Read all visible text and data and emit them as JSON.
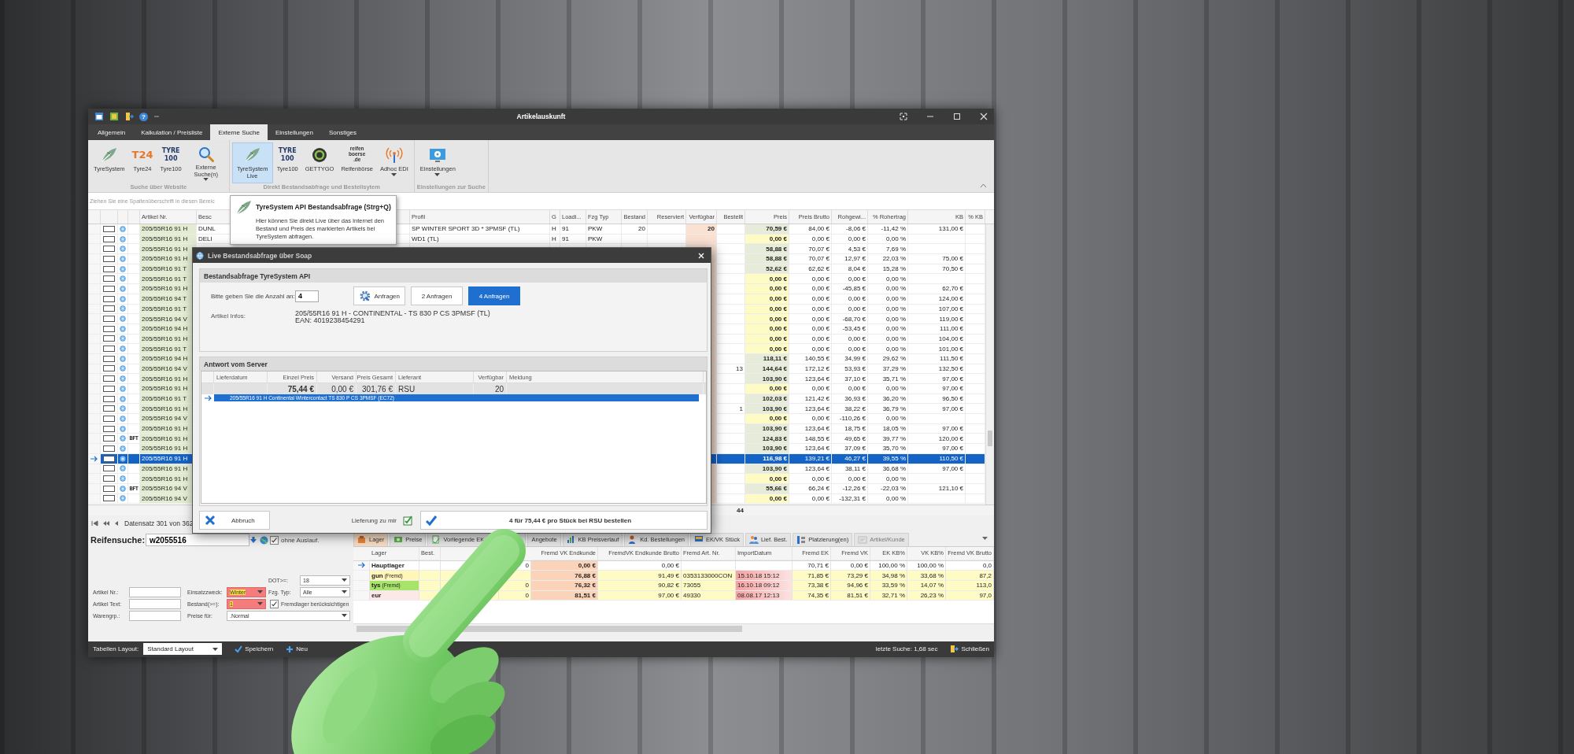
{
  "window": {
    "title": "Artikelauskunft",
    "help": "?"
  },
  "ribbon_tabs": [
    {
      "label": "Allgemein",
      "selected": false
    },
    {
      "label": "Kalkulation / Preisliste",
      "selected": false
    },
    {
      "label": "Externe Suche",
      "selected": true
    },
    {
      "label": "Einstellungen",
      "selected": false
    },
    {
      "label": "Sonstiges",
      "selected": false
    }
  ],
  "ribbon_groups": [
    {
      "label": "Suche über Website",
      "buttons": [
        {
          "label": "TyreSystem",
          "kind": "leaf",
          "dropdown": false,
          "selected": false
        },
        {
          "label": "Tyre24",
          "kind": "t24",
          "logo": "T24",
          "dropdown": false,
          "selected": false
        },
        {
          "label": "Tyre100",
          "kind": "tyre100",
          "logo": "TYRE\n100",
          "dropdown": false,
          "selected": false
        },
        {
          "label": "Externe Suche(n)",
          "kind": "magnifier",
          "dropdown": true,
          "selected": false
        }
      ]
    },
    {
      "label": "Direkt Bestandsabfrage und Bestellsytem",
      "buttons": [
        {
          "label": "TyreSystem Live",
          "kind": "leaf",
          "dropdown": false,
          "selected": true
        },
        {
          "label": "Tyre100",
          "kind": "tyre100",
          "logo": "TYRE\n100",
          "dropdown": false,
          "selected": false
        },
        {
          "label": "GETTYGO",
          "kind": "ring",
          "dropdown": false,
          "selected": false
        },
        {
          "label": "Reifenbörse",
          "kind": "boerse",
          "logo": "reifen\nboerse\n.de",
          "dropdown": false,
          "selected": false
        },
        {
          "label": "Adhoc EDI",
          "kind": "antenna",
          "dropdown": true,
          "selected": false
        }
      ]
    },
    {
      "label": "Einstellungen zur Suche",
      "buttons": [
        {
          "label": "Einstellungen",
          "kind": "settings",
          "dropdown": true,
          "selected": false
        }
      ]
    }
  ],
  "group_hint": "Ziehen Sie eine Spaltenüberschrift in diesen Bereic",
  "tooltip": {
    "title": "TyreSystem API Bestandsabfrage (Strg+Q)",
    "text": "Hier können Sie direkt Live über das Internet den Bestand und Preis des markierten Artikels bei TyreSystem abfragen."
  },
  "table": {
    "columns": [
      "Artikel Nr.",
      "Besc",
      "Profil",
      "G",
      "Loadi...",
      "Fzg Typ",
      "Bestand",
      "Reserviert",
      "Verfügbar",
      "Bestellt",
      "Preis",
      "Preis Brutto",
      "Rohgewi...",
      "% Rohertrag",
      "KB",
      "% KB"
    ],
    "rows": [
      {
        "artikel": "205/55R16 91 H",
        "besch": "DUNL",
        "profil": "SP WINTER SPORT 3D * 3PMSF (TL)",
        "g": "H",
        "load": "91",
        "fzg": "PKW",
        "bestand": "20",
        "verfuegbar": "20",
        "preis": "70,59 €",
        "highlight": false,
        "brutto": "84,00 €",
        "rohgewinn": "-8,06 €",
        "rohertrag": "-11,42 %",
        "kb": "131,00 €",
        "checked": false,
        "selected": false
      },
      {
        "artikel": "205/55R16 91 H",
        "besch": "DELI",
        "profil": "WD1 (TL)",
        "g": "H",
        "load": "91",
        "fzg": "PKW",
        "preis": "0,00 €",
        "highlight": true,
        "brutto": "0,00 €",
        "rohgewinn": "0,00 €",
        "rohertrag": "0,00 %",
        "checked": false,
        "selected": false
      },
      {
        "artikel": "205/55R16 91 H",
        "preis": "58,88 €",
        "highlight": false,
        "brutto": "70,07 €",
        "rohgewinn": "4,53 €",
        "rohertrag": "7,69 %",
        "checked": false,
        "selected": false
      },
      {
        "artikel": "205/55R16 91 H",
        "preis": "58,88 €",
        "highlight": false,
        "brutto": "70,07 €",
        "rohgewinn": "12,97 €",
        "rohertrag": "22,03 %",
        "kb": "75,00 €",
        "checked": false,
        "selected": false
      },
      {
        "artikel": "205/55R16 91 T",
        "preis": "52,62 €",
        "highlight": false,
        "brutto": "62,62 €",
        "rohgewinn": "8,04 €",
        "rohertrag": "15,28 %",
        "kb": "70,50 €",
        "checked": false,
        "selected": false
      },
      {
        "artikel": "205/55R16 91 T",
        "preis": "0,00 €",
        "highlight": true,
        "brutto": "0,00 €",
        "rohgewinn": "0,00 €",
        "rohertrag": "0,00 %",
        "checked": false,
        "selected": false
      },
      {
        "artikel": "205/55R16 91 H",
        "preis": "0,00 €",
        "highlight": true,
        "brutto": "0,00 €",
        "rohgewinn": "-45,85 €",
        "rohertrag": "0,00 %",
        "kb": "62,70 €",
        "checked": false,
        "selected": false
      },
      {
        "artikel": "205/55R16 94 T",
        "preis": "0,00 €",
        "highlight": true,
        "brutto": "0,00 €",
        "rohgewinn": "0,00 €",
        "rohertrag": "0,00 %",
        "kb": "124,00 €",
        "checked": false,
        "selected": false
      },
      {
        "artikel": "205/55R16 91 T",
        "preis": "0,00 €",
        "highlight": true,
        "brutto": "0,00 €",
        "rohgewinn": "0,00 €",
        "rohertrag": "0,00 %",
        "kb": "107,00 €",
        "checked": false,
        "selected": false
      },
      {
        "artikel": "205/55R16 94 V",
        "preis": "0,00 €",
        "highlight": true,
        "brutto": "0,00 €",
        "rohgewinn": "-68,70 €",
        "rohertrag": "0,00 %",
        "kb": "119,00 €",
        "checked": false,
        "selected": false
      },
      {
        "artikel": "205/55R16 94 H",
        "preis": "0,00 €",
        "highlight": true,
        "brutto": "0,00 €",
        "rohgewinn": "-53,45 €",
        "rohertrag": "0,00 %",
        "kb": "111,00 €",
        "checked": false,
        "selected": false
      },
      {
        "artikel": "205/55R16 91 H",
        "preis": "0,00 €",
        "highlight": true,
        "brutto": "0,00 €",
        "rohgewinn": "0,00 €",
        "rohertrag": "0,00 %",
        "kb": "104,00 €",
        "checked": false,
        "selected": false
      },
      {
        "artikel": "205/55R16 91 T",
        "preis": "0,00 €",
        "highlight": true,
        "brutto": "0,00 €",
        "rohgewinn": "0,00 €",
        "rohertrag": "0,00 %",
        "kb": "101,00 €",
        "checked": false,
        "selected": false
      },
      {
        "artikel": "205/55R16 94 H",
        "preis": "118,11 €",
        "highlight": false,
        "brutto": "140,55 €",
        "rohgewinn": "34,99 €",
        "rohertrag": "29,62 %",
        "kb": "111,50 €",
        "checked": false,
        "selected": false
      },
      {
        "artikel": "205/55R16 94 V",
        "bestellt": "13",
        "preis": "144,64 €",
        "highlight": false,
        "brutto": "172,12 €",
        "rohgewinn": "53,93 €",
        "rohertrag": "37,29 %",
        "kb": "132,50 €",
        "checked": false,
        "selected": false
      },
      {
        "artikel": "205/55R16 91 H",
        "preis": "103,90 €",
        "highlight": false,
        "brutto": "123,64 €",
        "rohgewinn": "37,10 €",
        "rohertrag": "35,71 %",
        "kb": "97,00 €",
        "checked": false,
        "selected": false
      },
      {
        "artikel": "205/55R16 91 H",
        "preis": "0,00 €",
        "highlight": true,
        "brutto": "0,00 €",
        "rohgewinn": "0,00 €",
        "rohertrag": "0,00 %",
        "kb": "97,00 €",
        "checked": false,
        "selected": false
      },
      {
        "artikel": "205/55R16 91 T",
        "preis": "102,03 €",
        "highlight": false,
        "brutto": "121,42 €",
        "rohgewinn": "36,93 €",
        "rohertrag": "36,20 %",
        "kb": "96,50 €",
        "checked": false,
        "selected": false
      },
      {
        "artikel": "205/55R16 91 H",
        "bestellt": "1",
        "preis": "103,90 €",
        "highlight": false,
        "brutto": "123,64 €",
        "rohgewinn": "38,22 €",
        "rohertrag": "36,79 %",
        "kb": "97,00 €",
        "checked": false,
        "selected": false
      },
      {
        "artikel": "205/55R16 94 V",
        "preis": "0,00 €",
        "highlight": true,
        "brutto": "0,00 €",
        "rohgewinn": "-110,26 €",
        "rohertrag": "0,00 %",
        "checked": false,
        "selected": false
      },
      {
        "artikel": "205/55R16 91 H",
        "preis": "103,90 €",
        "highlight": false,
        "brutto": "123,64 €",
        "rohgewinn": "18,75 €",
        "rohertrag": "18,05 %",
        "kb": "97,00 €",
        "checked": false,
        "selected": false
      },
      {
        "artikel": "205/55R16 91 H",
        "badge": "BFT",
        "preis": "124,83 €",
        "highlight": false,
        "brutto": "148,55 €",
        "rohgewinn": "49,65 €",
        "rohertrag": "39,77 %",
        "kb": "120,00 €",
        "checked": false,
        "selected": false
      },
      {
        "artikel": "205/55R16 91 H",
        "preis": "103,90 €",
        "highlight": false,
        "brutto": "123,64 €",
        "rohgewinn": "37,09 €",
        "rohertrag": "35,70 %",
        "kb": "97,00 €",
        "checked": false,
        "selected": false
      },
      {
        "artikel": "205/55R16 91 H",
        "preis": "116,98 €",
        "brutto": "139,21 €",
        "rohgewinn": "46,27 €",
        "rohertrag": "39,55 %",
        "kb": "110,50 €",
        "checked": false,
        "selected": true
      },
      {
        "artikel": "205/55R16 91 H",
        "preis": "103,90 €",
        "highlight": false,
        "brutto": "123,64 €",
        "rohgewinn": "38,11 €",
        "rohertrag": "36,68 %",
        "kb": "97,00 €",
        "checked": false,
        "selected": false
      },
      {
        "artikel": "205/55R16 91 H",
        "preis": "0,00 €",
        "highlight": true,
        "brutto": "0,00 €",
        "rohgewinn": "0,00 €",
        "rohertrag": "0,00 %",
        "checked": false,
        "selected": false
      },
      {
        "artikel": "205/55R16 94 V",
        "badge": "BFT",
        "preis": "55,66 €",
        "highlight": false,
        "brutto": "66,24 €",
        "rohgewinn": "-12,26 €",
        "rohertrag": "-22,03 %",
        "kb": "121,10 €",
        "checked": false,
        "selected": false
      },
      {
        "artikel": "205/55R16 94 V",
        "preis": "0,00 €",
        "highlight": true,
        "brutto": "0,00 €",
        "rohgewinn": "-132,31 €",
        "rohertrag": "0,00 %",
        "checked": false,
        "selected": false
      }
    ],
    "totals": {
      "bestellt": "44"
    },
    "pager": "Datensatz 301 von 362"
  },
  "dialog": {
    "title": "Live Bestandsabfrage über Soap",
    "query": {
      "title": "Bestandsabfrage TyreSystem API",
      "quantity_label": "Bitte geben Sie die Anzahl an:",
      "quantity": "4",
      "buttons": [
        {
          "label": "Anfragen",
          "kind": "gear",
          "selected": false
        },
        {
          "label": "2 Anfragen",
          "kind": "plain",
          "selected": false
        },
        {
          "label": "4 Anfragen",
          "kind": "plain",
          "selected": true
        }
      ],
      "info_label": "Artikel Infos:",
      "info_lines": [
        "205/55R16 91 H - CONTINENTAL - TS 830 P CS 3PMSF (TL)",
        "EAN: 4019238454291"
      ]
    },
    "response": {
      "title": "Antwort vom Server",
      "columns": [
        "Lieferdatum",
        "Einzel Preis",
        "Versand",
        "Preis Gesamt",
        "Lieferant",
        "Verfügbar",
        "Meldung"
      ],
      "rows": [
        {
          "einzel": "75,44 €",
          "versand": "0,00 €",
          "gesamt": "301,76 €",
          "lieferant": "RSU",
          "verfuegbar": "20",
          "detail": "205/55R16 91 H Continental Wintercontact TS 830 P CS 3PMSF (EC72)",
          "selected": true
        }
      ]
    },
    "cancel": "Abbruch",
    "delivery_label": "Lieferung zu mir",
    "order": "4 für 75,44 € pro Stück bei RSU bestellen"
  },
  "search": {
    "label": "Reifensuche:",
    "value": "w2055516",
    "exclude_discontinued": {
      "label": "ohne Auslauf.",
      "checked": true
    },
    "dot": {
      "label": "DOT>=:",
      "value": "18",
      "highlight": false
    },
    "fields": [
      {
        "label": "Artikel Nr.:"
      },
      {
        "label": "Artikel Text:"
      },
      {
        "label": "Warengrp.:"
      }
    ],
    "einsatz": {
      "label": "Einsatzzweck:",
      "value": "Winter",
      "highlight": true
    },
    "fzg": {
      "label": "Fzg. Typ:",
      "value": "Alle",
      "highlight": false
    },
    "bestand": {
      "label": "Bestand(>=):",
      "value": "1",
      "highlight": true
    },
    "fremdlager": {
      "label": "Fremdlager berücksichtigen",
      "checked": true
    },
    "preise": {
      "label": "Preise für:",
      "value": ".Normal",
      "highlight": false
    }
  },
  "detail": {
    "tabs": [
      {
        "label": "Lager",
        "kind": "box",
        "selected": true,
        "disabled": false
      },
      {
        "label": "Preise",
        "kind": "money",
        "selected": false,
        "disabled": false
      },
      {
        "label": "Vorliegende EK",
        "kind": "doc",
        "selected": false,
        "disabled": false
      },
      {
        "label": "Angebote",
        "kind": "plain",
        "selected": false,
        "disabled": false
      },
      {
        "label": "KB Preisverlauf",
        "kind": "chart",
        "selected": false,
        "disabled": false
      },
      {
        "label": "Kd. Bestellungen",
        "kind": "person",
        "selected": false,
        "disabled": false
      },
      {
        "label": "EK/VK Stück",
        "kind": "monitor",
        "selected": false,
        "disabled": false
      },
      {
        "label": "Lief. Best.",
        "kind": "people",
        "selected": false,
        "disabled": false
      },
      {
        "label": "Platzierung(en)",
        "kind": "place",
        "selected": false,
        "disabled": false
      },
      {
        "label": "Artikel/Kunde",
        "kind": "link",
        "selected": false,
        "disabled": true
      }
    ],
    "columns": [
      "Lager",
      "Best.",
      "Fremd VK Endkunde",
      "FremdVK Endkunde Brutto",
      "Fremd Art. Nr.",
      "ImportDatum",
      "Fremd EK",
      "Fremd VK",
      "EK KB%",
      "VK KB%",
      "Fremd VK Brutto"
    ],
    "rows": [
      {
        "lager": "Hauptlager",
        "col_3": "0",
        "vk_endkunde": "0,00 €",
        "vk_endkunde_brutto": "0,00 €",
        "fremd_ek": "70,71 €",
        "fremd_vk": "0,00 €",
        "ek_kb": "100,00 %",
        "vk_kb": "100,00 %",
        "vk_brutto": "0,0",
        "color": "#ffffff",
        "highlight": false,
        "selected": true
      },
      {
        "lager": "gun",
        "tag": "(Fremd)",
        "vk_endkunde": "76,88 €",
        "vk_endkunde_brutto": "91,49 €",
        "art_nr": "0353133000CON",
        "import": "15.10.18 15:12",
        "fremd_ek": "71,85 €",
        "fremd_vk": "73,29 €",
        "ek_kb": "34,98 %",
        "vk_kb": "33,68 %",
        "vk_brutto": "87,2",
        "color": "#fff6b8",
        "highlight": true,
        "selected": false
      },
      {
        "lager": "tys",
        "tag": "(Fremd)",
        "col_3": "0",
        "vk_endkunde": "76,32 €",
        "vk_endkunde_brutto": "90,82 €",
        "art_nr": "73055",
        "import": "16.10.18 09:12",
        "fremd_ek": "73,38 €",
        "fremd_vk": "94,96 €",
        "ek_kb": "33,59 %",
        "vk_kb": "14,07 %",
        "vk_brutto": "113,0",
        "color": "#a8e36a",
        "highlight": true,
        "selected": false
      },
      {
        "lager": "eur",
        "col_3": "0",
        "vk_endkunde": "81,51 €",
        "vk_endkunde_brutto": "97,00 €",
        "art_nr": "49330",
        "import": "08.08.17 12:13",
        "fremd_ek": "74,35 €",
        "fremd_vk": "81,51 €",
        "ek_kb": "32,71 %",
        "vk_kb": "26,23 %",
        "vk_brutto": "97,0",
        "color": "#fde8e8",
        "highlight": true,
        "selected": false
      }
    ]
  },
  "status_bar": {
    "layout_label": "Tabellen Layout:",
    "layout_value": "Standard Layout",
    "save": "Speichern",
    "new": "Neu",
    "last_search": "letzte Suche: 1,68 sec",
    "close": "Schließen"
  }
}
